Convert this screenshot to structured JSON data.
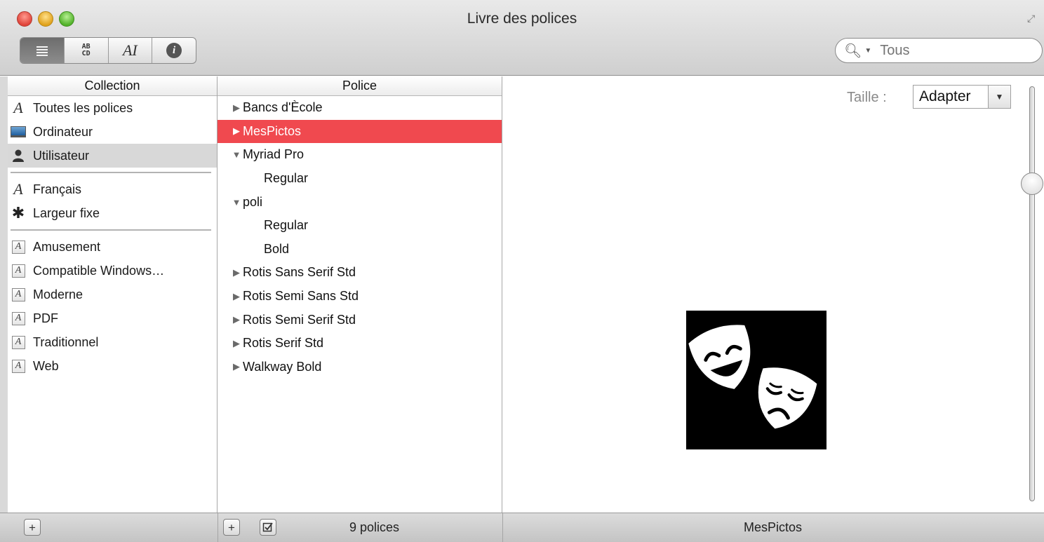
{
  "window": {
    "title": "Livre des polices"
  },
  "toolbar": {
    "view_buttons": [
      {
        "name": "list-view",
        "icon": "lines-icon"
      },
      {
        "name": "sample-view",
        "label": "AB\nCD",
        "icon": "ab-cd-icon"
      },
      {
        "name": "custom-view",
        "label": "AI",
        "icon": "ai-icon"
      },
      {
        "name": "info-view",
        "label": "i",
        "icon": "info-icon"
      }
    ],
    "search": {
      "placeholder": "Tous"
    }
  },
  "collection": {
    "header": "Collection",
    "groups": [
      [
        {
          "label": "Toutes les polices",
          "icon": "script-a-icon"
        },
        {
          "label": "Ordinateur",
          "icon": "computer-icon"
        },
        {
          "label": "Utilisateur",
          "icon": "user-icon",
          "selected": true
        }
      ],
      [
        {
          "label": "Français",
          "icon": "script-a-icon"
        },
        {
          "label": "Largeur fixe",
          "icon": "gear-icon"
        }
      ],
      [
        {
          "label": "Amusement",
          "icon": "font-box-icon"
        },
        {
          "label": "Compatible Windows…",
          "icon": "font-box-icon"
        },
        {
          "label": "Moderne",
          "icon": "font-box-icon"
        },
        {
          "label": "PDF",
          "icon": "font-box-icon"
        },
        {
          "label": "Traditionnel",
          "icon": "font-box-icon"
        },
        {
          "label": "Web",
          "icon": "font-box-icon"
        }
      ]
    ]
  },
  "police": {
    "header": "Police",
    "rows": [
      {
        "label": "Bancs d'Ècole",
        "type": "family",
        "expanded": false
      },
      {
        "label": "MesPictos",
        "type": "family",
        "expanded": false,
        "selected": true
      },
      {
        "label": "Myriad Pro",
        "type": "family",
        "expanded": true
      },
      {
        "label": "Regular",
        "type": "style"
      },
      {
        "label": "poli",
        "type": "family",
        "expanded": true
      },
      {
        "label": "Regular",
        "type": "style"
      },
      {
        "label": "Bold",
        "type": "style"
      },
      {
        "label": "Rotis Sans Serif Std",
        "type": "family",
        "expanded": false
      },
      {
        "label": "Rotis Semi Sans Std",
        "type": "family",
        "expanded": false
      },
      {
        "label": "Rotis Semi Serif Std",
        "type": "family",
        "expanded": false
      },
      {
        "label": "Rotis Serif Std",
        "type": "family",
        "expanded": false
      },
      {
        "label": "Walkway Bold",
        "type": "family",
        "expanded": false
      }
    ]
  },
  "preview": {
    "size_label": "Taille :",
    "size_value": "Adapter",
    "slider_level": 0.22,
    "glyph_icon": "theater-masks-icon"
  },
  "status": {
    "count_text": "9 polices",
    "selected_font": "MesPictos"
  },
  "colors": {
    "selection": "#f0494f",
    "sidebar_selection": "#d8d8d8"
  }
}
